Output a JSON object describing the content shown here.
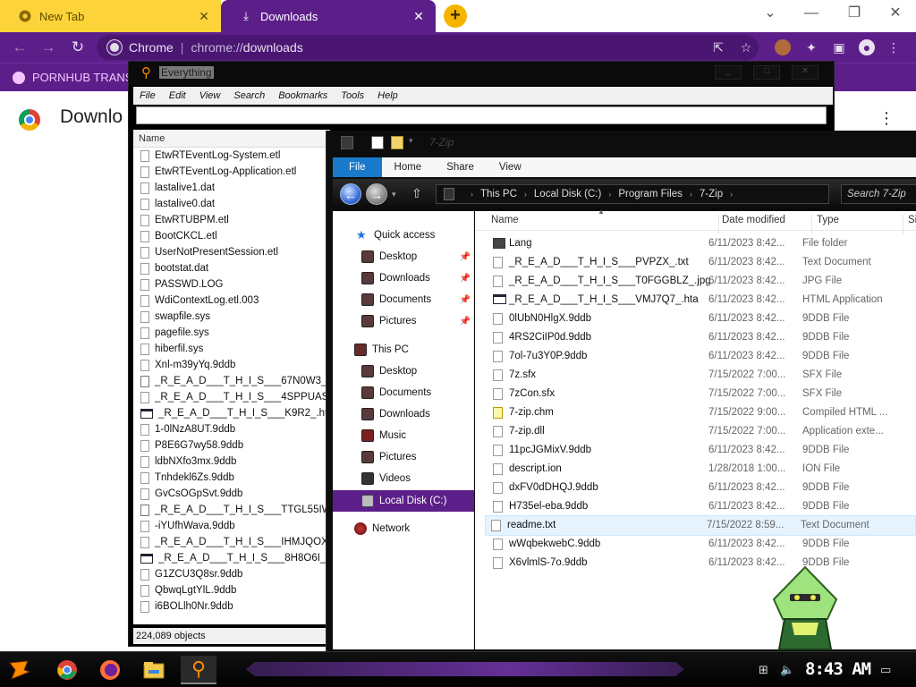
{
  "browser": {
    "tabs": [
      {
        "title": "New Tab",
        "icon": "chrome-icon"
      },
      {
        "title": "Downloads",
        "icon": "download-icon"
      }
    ],
    "omnibox": {
      "label": "Chrome",
      "url_prefix": "chrome://",
      "url_path": "downloads"
    },
    "bookmark": {
      "label": "PORNHUB TRANS"
    },
    "page_title": "Downlo",
    "theme_color": "#5c1f8a"
  },
  "everything": {
    "title": "Everything",
    "menu": [
      "File",
      "Edit",
      "View",
      "Search",
      "Bookmarks",
      "Tools",
      "Help"
    ],
    "search_value": "",
    "column_name": "Name",
    "files": [
      {
        "name": "EtwRTEventLog-System.etl",
        "icon": "file"
      },
      {
        "name": "EtwRTEventLog-Application.etl",
        "icon": "file"
      },
      {
        "name": "lastalive1.dat",
        "icon": "file"
      },
      {
        "name": "lastalive0.dat",
        "icon": "file"
      },
      {
        "name": "EtwRTUBPM.etl",
        "icon": "file"
      },
      {
        "name": "BootCKCL.etl",
        "icon": "file"
      },
      {
        "name": "UserNotPresentSession.etl",
        "icon": "file"
      },
      {
        "name": "bootstat.dat",
        "icon": "file"
      },
      {
        "name": "PASSWD.LOG",
        "icon": "file"
      },
      {
        "name": "WdiContextLog.etl.003",
        "icon": "file"
      },
      {
        "name": "swapfile.sys",
        "icon": "file"
      },
      {
        "name": "pagefile.sys",
        "icon": "file"
      },
      {
        "name": "hiberfil.sys",
        "icon": "file"
      },
      {
        "name": "Xnl-m39yYq.9ddb",
        "icon": "file"
      },
      {
        "name": "_R_E_A_D___T_H_I_S___67N0W3_.jpg",
        "icon": "img"
      },
      {
        "name": "_R_E_A_D___T_H_I_S___4SPPUAS9_.t",
        "icon": "file"
      },
      {
        "name": "_R_E_A_D___T_H_I_S___K9R2_.hta",
        "icon": "hta"
      },
      {
        "name": "1-0lNzA8UT.9ddb",
        "icon": "file"
      },
      {
        "name": "P8E6G7wy58.9ddb",
        "icon": "file"
      },
      {
        "name": "ldbNXfo3mx.9ddb",
        "icon": "file"
      },
      {
        "name": "Tnhdekl6Zs.9ddb",
        "icon": "file"
      },
      {
        "name": "GvCsOGpSvt.9ddb",
        "icon": "file"
      },
      {
        "name": "_R_E_A_D___T_H_I_S___TTGL55IW_.jp",
        "icon": "img"
      },
      {
        "name": "-iYUfhWava.9ddb",
        "icon": "file"
      },
      {
        "name": "_R_E_A_D___T_H_I_S___IHMJQOX_.tx",
        "icon": "file"
      },
      {
        "name": "_R_E_A_D___T_H_I_S___8H8O6I_.hta",
        "icon": "hta"
      },
      {
        "name": "G1ZCU3Q8sr.9ddb",
        "icon": "file"
      },
      {
        "name": "QbwqLgtYlL.9ddb",
        "icon": "file"
      },
      {
        "name": "i6BOLlh0Nr.9ddb",
        "icon": "file"
      }
    ],
    "status": "224,089 objects"
  },
  "explorer": {
    "title": "7-Zip",
    "ribbon_tabs": [
      "File",
      "Home",
      "Share",
      "View"
    ],
    "breadcrumb": [
      "This PC",
      "Local Disk (C:)",
      "Program Files",
      "7-Zip"
    ],
    "search_placeholder": "Search 7-Zip",
    "nav": {
      "quick_access": "Quick access",
      "quick_items": [
        "Desktop",
        "Downloads",
        "Documents",
        "Pictures"
      ],
      "this_pc": "This PC",
      "pc_items": [
        "Desktop",
        "Documents",
        "Downloads",
        "Music",
        "Pictures",
        "Videos",
        "Local Disk (C:)"
      ],
      "network": "Network"
    },
    "columns": {
      "name": "Name",
      "date": "Date modified",
      "type": "Type",
      "size": "Si"
    },
    "rows": [
      {
        "name": "Lang",
        "date": "6/11/2023 8:42...",
        "type": "File folder",
        "icon": "folder"
      },
      {
        "name": "_R_E_A_D___T_H_I_S___PVPZX_.txt",
        "date": "6/11/2023 8:42...",
        "type": "Text Document",
        "icon": "file"
      },
      {
        "name": "_R_E_A_D___T_H_I_S___T0FGGBLZ_.jpg",
        "date": "6/11/2023 8:42...",
        "type": "JPG File",
        "icon": "file"
      },
      {
        "name": "_R_E_A_D___T_H_I_S___VMJ7Q7_.hta",
        "date": "6/11/2023 8:42...",
        "type": "HTML Application",
        "icon": "hta"
      },
      {
        "name": "0lUbN0HlgX.9ddb",
        "date": "6/11/2023 8:42...",
        "type": "9DDB File",
        "icon": "file"
      },
      {
        "name": "4RS2CiIP0d.9ddb",
        "date": "6/11/2023 8:42...",
        "type": "9DDB File",
        "icon": "file"
      },
      {
        "name": "7ol-7u3Y0P.9ddb",
        "date": "6/11/2023 8:42...",
        "type": "9DDB File",
        "icon": "file"
      },
      {
        "name": "7z.sfx",
        "date": "7/15/2022 7:00...",
        "type": "SFX File",
        "icon": "file"
      },
      {
        "name": "7zCon.sfx",
        "date": "7/15/2022 7:00...",
        "type": "SFX File",
        "icon": "file"
      },
      {
        "name": "7-zip.chm",
        "date": "7/15/2022 9:00...",
        "type": "Compiled HTML ...",
        "icon": "chm"
      },
      {
        "name": "7-zip.dll",
        "date": "7/15/2022 7:00...",
        "type": "Application exte...",
        "icon": "file"
      },
      {
        "name": "11pcJGMixV.9ddb",
        "date": "6/11/2023 8:42...",
        "type": "9DDB File",
        "icon": "file"
      },
      {
        "name": "descript.ion",
        "date": "1/28/2018 1:00...",
        "type": "ION File",
        "icon": "file"
      },
      {
        "name": "dxFV0dDHQJ.9ddb",
        "date": "6/11/2023 8:42...",
        "type": "9DDB File",
        "icon": "file"
      },
      {
        "name": "H735el-eba.9ddb",
        "date": "6/11/2023 8:42...",
        "type": "9DDB File",
        "icon": "file"
      },
      {
        "name": "readme.txt",
        "date": "7/15/2022 8:59...",
        "type": "Text Document",
        "icon": "file",
        "hover": true
      },
      {
        "name": "wWqbekwebC.9ddb",
        "date": "6/11/2023 8:42...",
        "type": "9DDB File",
        "icon": "file"
      },
      {
        "name": "X6vlmlS-7o.9ddb",
        "date": "6/11/2023 8:42...",
        "type": "9DDB File",
        "icon": "file"
      }
    ]
  },
  "taskbar": {
    "clock": "8:43 AM",
    "apps": [
      "start-icon",
      "chrome-icon",
      "firefox-icon",
      "file-explorer-icon",
      "everything-icon"
    ]
  }
}
